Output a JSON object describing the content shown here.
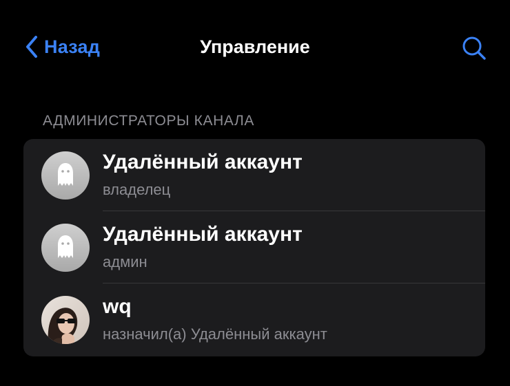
{
  "nav": {
    "back_label": "Назад",
    "title": "Управление",
    "icons": {
      "back": "chevron-left-icon",
      "search": "search-icon"
    }
  },
  "section": {
    "header": "АДМИНИСТРАТОРЫ КАНАЛА"
  },
  "admins": [
    {
      "name": "Удалённый аккаунт",
      "role": "владелец",
      "avatar": "ghost-icon"
    },
    {
      "name": "Удалённый аккаунт",
      "role": "админ",
      "avatar": "ghost-icon"
    },
    {
      "name": "wq",
      "role": "назначил(а) Удалённый аккаунт",
      "avatar": "user-photo"
    }
  ],
  "colors": {
    "accent": "#3b82f6",
    "background": "#000000",
    "card": "#1c1c1e",
    "secondary_text": "#8d8d93"
  }
}
